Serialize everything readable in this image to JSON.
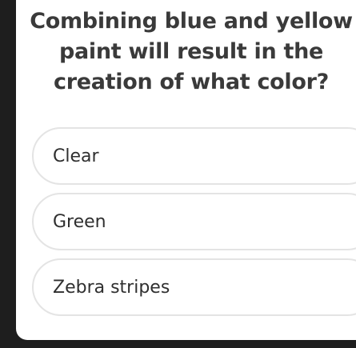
{
  "quiz": {
    "question": "Combining blue and yellow paint will result in the creation of what color?",
    "options": [
      {
        "label": "Clear"
      },
      {
        "label": "Green"
      },
      {
        "label": "Zebra stripes"
      }
    ]
  }
}
